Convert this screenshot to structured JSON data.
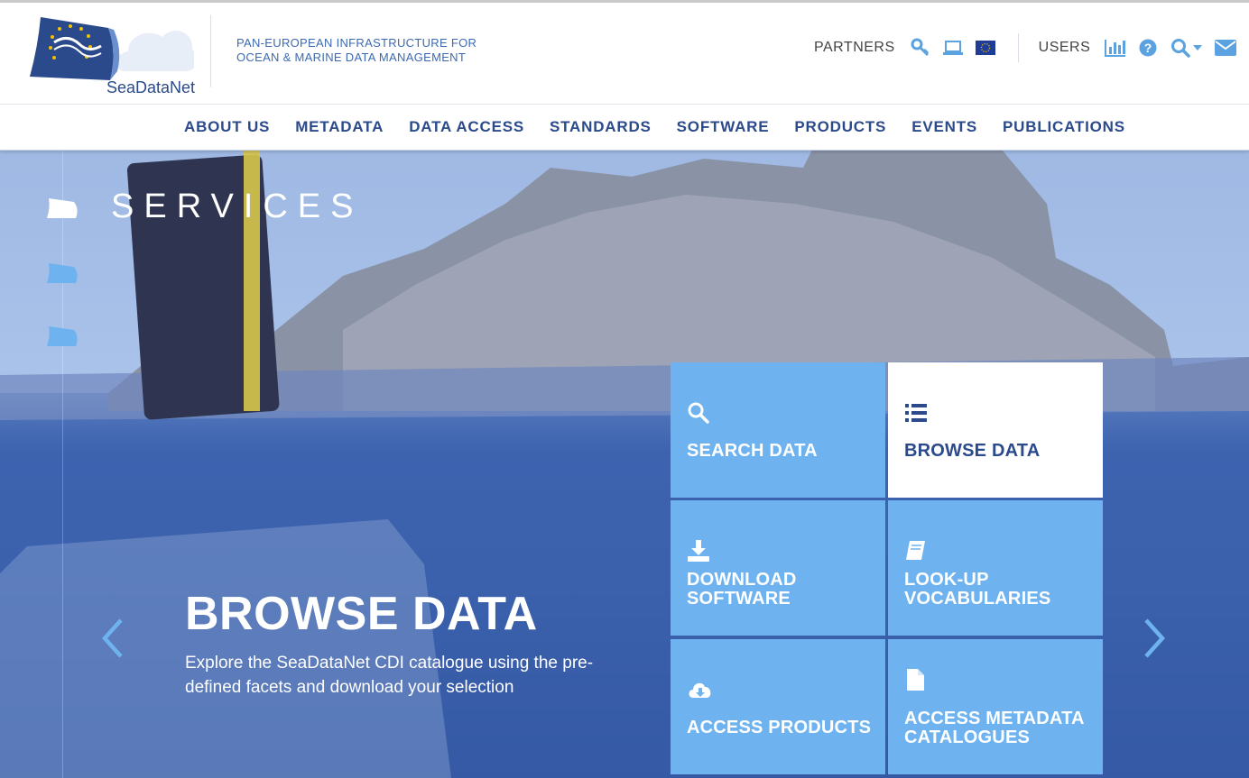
{
  "header": {
    "logo_text": "SeaDataNet",
    "tagline_line1": "PAN-EUROPEAN INFRASTRUCTURE FOR",
    "tagline_line2": "OCEAN & MARINE DATA MANAGEMENT",
    "partners_label": "PARTNERS",
    "users_label": "USERS",
    "icons": [
      "key-icon",
      "laptop-icon",
      "eu-flag-icon",
      "bar-chart-icon",
      "help-icon",
      "search-icon",
      "caret-down-icon",
      "envelope-icon"
    ]
  },
  "nav": {
    "items": [
      "ABOUT US",
      "METADATA",
      "DATA ACCESS",
      "STANDARDS",
      "SOFTWARE",
      "PRODUCTS",
      "EVENTS",
      "PUBLICATIONS"
    ]
  },
  "hero": {
    "section_title": "SERVICES",
    "headline": "BROWSE DATA",
    "description": "Explore the SeaDataNet CDI catalogue using the pre-defined facets and download your selection"
  },
  "tiles": [
    {
      "label_line1": "SEARCH DATA",
      "label_line2": "",
      "icon": "search-icon",
      "active": false
    },
    {
      "label_line1": "BROWSE DATA",
      "label_line2": "",
      "icon": "list-icon",
      "active": true
    },
    {
      "label_line1": "DOWNLOAD",
      "label_line2": "SOFTWARE",
      "icon": "download-icon",
      "active": false
    },
    {
      "label_line1": "LOOK-UP",
      "label_line2": "VOCABULARIES",
      "icon": "book-icon",
      "active": false
    },
    {
      "label_line1": "ACCESS PRODUCTS",
      "label_line2": "",
      "icon": "cloud-download-icon",
      "active": false
    },
    {
      "label_line1": "ACCESS METADATA",
      "label_line2": "CATALOGUES",
      "icon": "file-icon",
      "active": false
    }
  ],
  "colors": {
    "brand_blue": "#2b4a8b",
    "tile_blue": "#6eb3ef",
    "accent_light_blue": "#5aa2e0"
  }
}
